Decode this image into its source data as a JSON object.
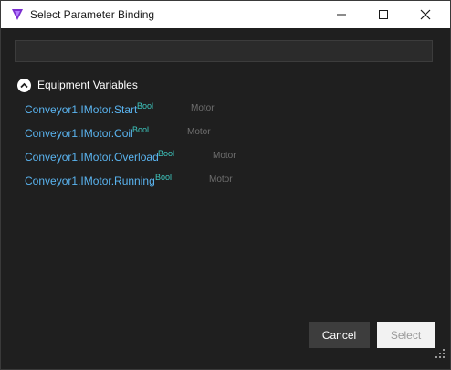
{
  "window": {
    "title": "Select Parameter Binding",
    "app_icon": "purple-triangle-icon",
    "controls": [
      "minimize-icon",
      "maximize-icon",
      "close-icon"
    ]
  },
  "search": {
    "value": "",
    "placeholder": ""
  },
  "group": {
    "title": "Equipment Variables",
    "collapse_icon": "chevron-up-icon",
    "items": [
      {
        "name": "Conveyor1.IMotor.Start",
        "type": "Bool",
        "category": "Motor"
      },
      {
        "name": "Conveyor1.IMotor.Coil",
        "type": "Bool",
        "category": "Motor"
      },
      {
        "name": "Conveyor1.IMotor.Overload",
        "type": "Bool",
        "category": "Motor"
      },
      {
        "name": "Conveyor1.IMotor.Running",
        "type": "Bool",
        "category": "Motor"
      }
    ]
  },
  "buttons": {
    "cancel": "Cancel",
    "select": "Select"
  },
  "colors": {
    "background": "#1f1f1f",
    "variable_name": "#5ab4f0",
    "type_badge": "#3ec8c0",
    "category": "#6f6f6f",
    "app_icon": "#8a2be2"
  }
}
